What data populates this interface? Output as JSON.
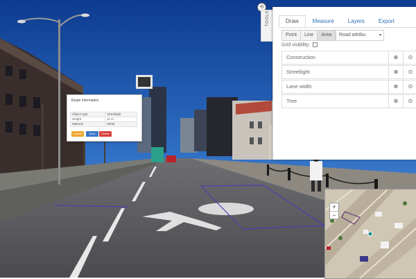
{
  "shape_info": {
    "title": "Shape information",
    "rows": [
      {
        "label": "Object type",
        "value": "Streetlight"
      },
      {
        "label": "Height",
        "value": "11 m"
      },
      {
        "label": "Material",
        "value": "Metal"
      }
    ],
    "buttons": {
      "cancel": "Cancel",
      "save": "Save",
      "delete": "Delete"
    }
  },
  "tools": {
    "tab_label": "TOOLS",
    "toggle_symbol": "⟲",
    "tabs": [
      {
        "label": "Draw",
        "active": true
      },
      {
        "label": "Measure",
        "active": false
      },
      {
        "label": "Layers",
        "active": false
      },
      {
        "label": "Export",
        "active": false
      }
    ],
    "modes": [
      {
        "label": "Point",
        "active": false
      },
      {
        "label": "Line",
        "active": false
      },
      {
        "label": "Area",
        "active": true
      }
    ],
    "select_value": "Road attribu",
    "grid_visibility_label": "Grid visibility:",
    "grid_visibility_checked": false,
    "layers": [
      {
        "name": "Construction"
      },
      {
        "name": "Streetlight"
      },
      {
        "name": "Lane width"
      },
      {
        "name": "Tree"
      }
    ],
    "row_icons": [
      "target-icon",
      "eye-icon"
    ],
    "row_icon_symbols": [
      "⊗",
      "⊙"
    ]
  },
  "minimap": {
    "zoom_in": "+",
    "zoom_out": "−"
  },
  "colors": {
    "accent": "#2d6fb8",
    "cancel": "#f0a830",
    "save": "#3a78c8",
    "delete": "#d9403a",
    "overlay_line": "#4a3fb0"
  }
}
